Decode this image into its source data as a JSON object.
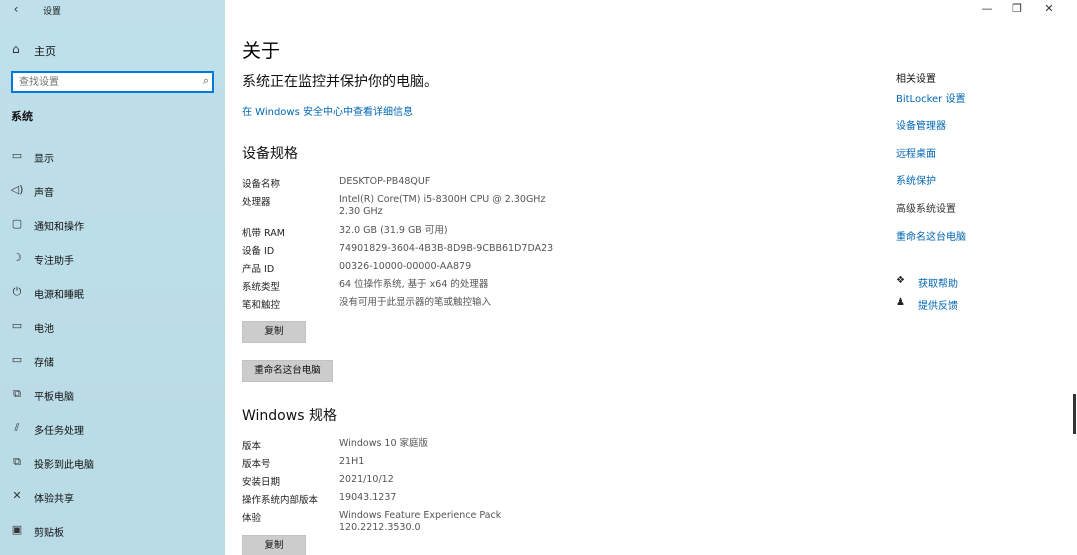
{
  "window": {
    "title": "设置",
    "back_icon": "‹",
    "minimize": "—",
    "maximize": "❐",
    "close": "✕"
  },
  "sidebar": {
    "home": {
      "icon": "home-icon",
      "label": "主页"
    },
    "search": {
      "placeholder": "查找设置",
      "value": ""
    },
    "section": "系统",
    "items": [
      {
        "name": "display",
        "icon": "monitor-icon",
        "label": "显示"
      },
      {
        "name": "sound",
        "icon": "speaker-icon",
        "label": "声音"
      },
      {
        "name": "notifications",
        "icon": "message-icon",
        "label": "通知和操作"
      },
      {
        "name": "focus",
        "icon": "moon-icon",
        "label": "专注助手"
      },
      {
        "name": "power",
        "icon": "power-icon",
        "label": "电源和睡眠"
      },
      {
        "name": "battery",
        "icon": "battery-icon",
        "label": "电池"
      },
      {
        "name": "storage",
        "icon": "storage-icon",
        "label": "存储"
      },
      {
        "name": "tablet",
        "icon": "tablet-icon",
        "label": "平板电脑"
      },
      {
        "name": "multitasking",
        "icon": "multitask-icon",
        "label": "多任务处理"
      },
      {
        "name": "projecting",
        "icon": "project-icon",
        "label": "投影到此电脑"
      },
      {
        "name": "shared",
        "icon": "share-icon",
        "label": "体验共享"
      },
      {
        "name": "clipboard",
        "icon": "clipboard-icon",
        "label": "剪贴板"
      }
    ]
  },
  "main": {
    "title": "关于",
    "protect_text": "系统正在监控并保护你的电脑。",
    "security_link": "在 Windows 安全中心中查看详细信息",
    "device_specs": {
      "heading": "设备规格",
      "rows": [
        {
          "k": "设备名称",
          "v": "DESKTOP-PB48QUF"
        },
        {
          "k": "处理器",
          "v": "Intel(R) Core(TM) i5-8300H CPU @ 2.30GHz   2.30 GHz"
        },
        {
          "k": "机带 RAM",
          "v": "32.0 GB (31.9 GB 可用)"
        },
        {
          "k": "设备 ID",
          "v": "74901829-3604-4B3B-8D9B-9CBB61D7DA23"
        },
        {
          "k": "产品 ID",
          "v": "00326-10000-00000-AA879"
        },
        {
          "k": "系统类型",
          "v": "64 位操作系统, 基于 x64 的处理器"
        },
        {
          "k": "笔和触控",
          "v": "没有可用于此显示器的笔或触控输入"
        }
      ],
      "copy_button": "复制",
      "rename_button": "重命名这台电脑"
    },
    "windows_specs": {
      "heading": "Windows 规格",
      "rows": [
        {
          "k": "版本",
          "v": "Windows 10 家庭版"
        },
        {
          "k": "版本号",
          "v": "21H1"
        },
        {
          "k": "安装日期",
          "v": "2021/10/12"
        },
        {
          "k": "操作系统内部版本",
          "v": "19043.1237"
        },
        {
          "k": "体验",
          "v": "Windows Feature Experience Pack 120.2212.3530.0"
        }
      ],
      "copy_button": "复制"
    }
  },
  "related": {
    "title": "相关设置",
    "links": [
      {
        "label": "BitLocker 设置",
        "muted": false
      },
      {
        "label": "设备管理器",
        "muted": false
      },
      {
        "label": "远程桌面",
        "muted": false
      },
      {
        "label": "系统保护",
        "muted": false
      },
      {
        "label": "高级系统设置",
        "muted": true
      },
      {
        "label": "重命名这台电脑",
        "muted": false
      }
    ],
    "help": [
      {
        "icon": "chat-help-icon",
        "label": "获取帮助"
      },
      {
        "icon": "feedback-icon",
        "label": "提供反馈"
      }
    ]
  },
  "colors": {
    "accent": "#0078d7",
    "link": "#0066b4",
    "sidebar_bg": "#bcdde8",
    "button_bg": "#cccccc"
  }
}
